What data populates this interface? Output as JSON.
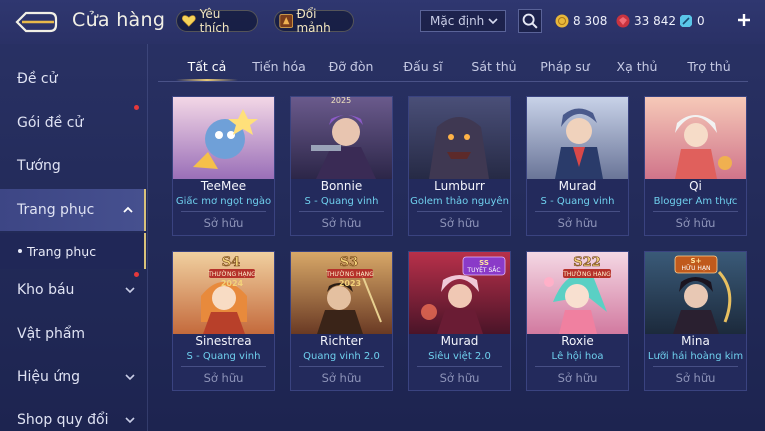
{
  "header": {
    "title": "Cửa hàng",
    "favorites_label": "Yêu thích",
    "exchange_label": "Đổi mảnh",
    "sort_value": "Mặc định",
    "currency": {
      "gold": "8 308",
      "ruby": "33 842",
      "voucher": "0"
    }
  },
  "sidebar": {
    "items": [
      {
        "label": "Đề cử"
      },
      {
        "label": "Gói đề cử"
      },
      {
        "label": "Tướng"
      },
      {
        "label": "Trang phục"
      },
      {
        "label": "Trang phục"
      },
      {
        "label": "Kho báu"
      },
      {
        "label": "Vật phẩm"
      },
      {
        "label": "Hiệu ứng"
      },
      {
        "label": "Shop quy đổi"
      }
    ]
  },
  "tabs": [
    "Tất cả",
    "Tiến hóa",
    "Đỡ đòn",
    "Đấu sĩ",
    "Sát thủ",
    "Pháp sư",
    "Xạ thủ",
    "Trợ thủ"
  ],
  "cards": [
    {
      "name": "TeeMee",
      "subtitle": "Giấc mơ ngọt ngào",
      "status": "Sở hữu",
      "badge": "",
      "badge_year": ""
    },
    {
      "name": "Bonnie",
      "subtitle": "S - Quang vinh",
      "status": "Sở hữu",
      "badge": "",
      "badge_year": "2025"
    },
    {
      "name": "Lumburr",
      "subtitle": "Golem thảo nguyên",
      "status": "Sở hữu",
      "badge": "",
      "badge_year": ""
    },
    {
      "name": "Murad",
      "subtitle": "S - Quang vinh",
      "status": "Sở hữu",
      "badge": "",
      "badge_year": ""
    },
    {
      "name": "Qi",
      "subtitle": "Blogger Ẩm thực",
      "status": "Sở hữu",
      "badge": "",
      "badge_year": ""
    },
    {
      "name": "Sinestrea",
      "subtitle": "S - Quang vinh",
      "status": "Sở hữu",
      "badge": "THƯỜNG HẠNG",
      "badge_season": "S4",
      "badge_year": "2024"
    },
    {
      "name": "Richter",
      "subtitle": "Quang vinh 2.0",
      "status": "Sở hữu",
      "badge": "THƯỜNG HẠNG",
      "badge_season": "S3",
      "badge_year": "2023"
    },
    {
      "name": "Murad",
      "subtitle": "Siêu việt 2.0",
      "status": "Sở hữu",
      "badge": "TUYỆT SẮC",
      "badge_season": "SS",
      "badge_year": ""
    },
    {
      "name": "Roxie",
      "subtitle": "Lễ hội hoa",
      "status": "Sở hữu",
      "badge": "THƯỜNG HẠNG",
      "badge_season": "S22",
      "badge_year": ""
    },
    {
      "name": "Mina",
      "subtitle": "Lưỡi hái hoàng kim",
      "status": "Sở hữu",
      "badge": "HỮU HẠN",
      "badge_season": "S+",
      "badge_year": ""
    }
  ],
  "colors": {
    "accent_gold": "#d9c27a",
    "subtitle_cyan": "#6fd0ee",
    "notification_red": "#e5383b",
    "background": "#252c5c"
  },
  "icons": {
    "back": "back-arrow-icon",
    "favorite": "heart-icon",
    "exchange": "shard-exchange-icon",
    "search": "search-icon",
    "gold": "gold-coin-icon",
    "ruby": "ruby-gem-icon",
    "voucher": "voucher-icon",
    "add": "plus-icon"
  }
}
